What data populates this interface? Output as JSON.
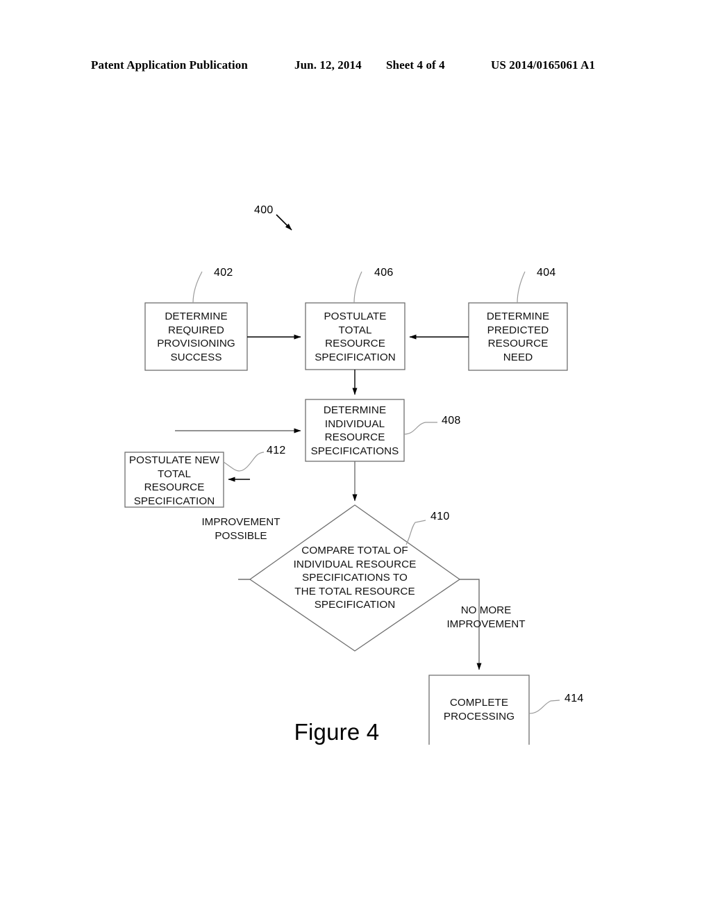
{
  "header": {
    "publication": "Patent Application Publication",
    "date": "Jun. 12, 2014",
    "sheet": "Sheet 4 of 4",
    "patent_number": "US 2014/0165061 A1"
  },
  "figure": {
    "caption": "Figure 4",
    "diagram_ref": "400",
    "line_color": "#6e6e6e",
    "arrow_color": "#000000",
    "text_color": "#111111"
  },
  "nodes": [
    {
      "ref": "402",
      "shape": "rect",
      "label": "DETERMINE\nREQUIRED\nPROVISIONING\nSUCCESS"
    },
    {
      "ref": "406",
      "shape": "rect",
      "label": "POSTULATE\nTOTAL\nRESOURCE\nSPECIFICATION"
    },
    {
      "ref": "404",
      "shape": "rect",
      "label": "DETERMINE\nPREDICTED\nRESOURCE\nNEED"
    },
    {
      "ref": "408",
      "shape": "rect",
      "label": "DETERMINE\nINDIVIDUAL\nRESOURCE\nSPECIFICATIONS"
    },
    {
      "ref": "412",
      "shape": "rect",
      "label": "POSTULATE NEW\nTOTAL\nRESOURCE\nSPECIFICATION"
    },
    {
      "ref": "410",
      "shape": "diamond",
      "label": "COMPARE TOTAL OF\nINDIVIDUAL RESOURCE\nSPECIFICATIONS TO\nTHE TOTAL RESOURCE\nSPECIFICATION"
    },
    {
      "ref": "414",
      "shape": "rect",
      "label": "COMPLETE\nPROCESSING"
    }
  ],
  "edge_labels": [
    {
      "id": "improvement_possible",
      "text": "IMPROVEMENT\nPOSSIBLE"
    },
    {
      "id": "no_more_improvement",
      "text": "NO MORE\nIMPROVEMENT"
    }
  ]
}
